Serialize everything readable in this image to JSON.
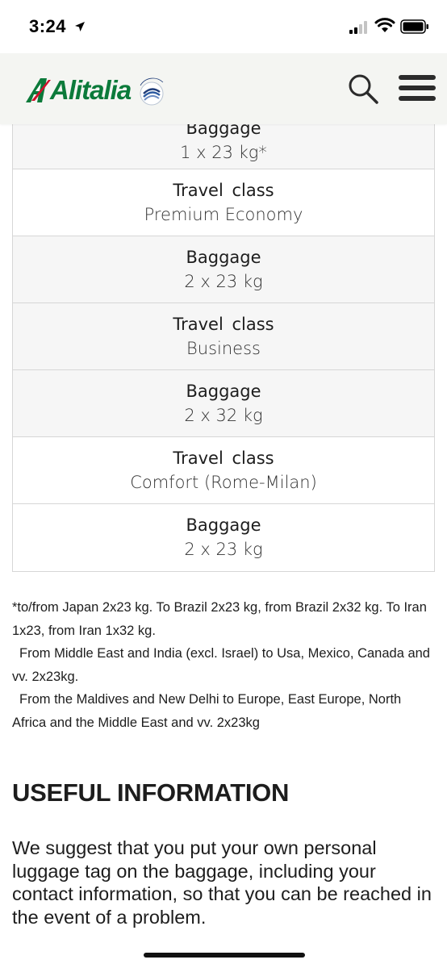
{
  "status_bar": {
    "time": "3:24"
  },
  "header": {
    "brand": "Alitalia",
    "partner_badge": "SKYTEAM",
    "brand_color": "#0b7a3a",
    "accent_color": "#d0102c",
    "search_icon": "search-icon",
    "menu_icon": "hamburger-menu-icon"
  },
  "table": {
    "rows": [
      {
        "label": "Baggage",
        "value": "1 x 23 kg*"
      },
      {
        "label": "Travel  class",
        "value": "Premium Economy"
      },
      {
        "label": "Baggage",
        "value": "2 x 23 kg"
      },
      {
        "label": "Travel  class",
        "value": "Business"
      },
      {
        "label": "Baggage",
        "value": "2 x 32 kg"
      },
      {
        "label": "Travel  class",
        "value": "Comfort (Rome-Milan)"
      },
      {
        "label": "Baggage",
        "value": "2 x 23 kg"
      }
    ]
  },
  "footnote": {
    "line1": "*to/from Japan 2x23 kg. To Brazil 2x23 kg, from Brazil 2x32 kg. To Iran 1x23, from Iran 1x32 kg.",
    "line2": "From Middle East and India (excl. Israel)  to Usa, Mexico, Canada and vv.  2x23kg.",
    "line3": "From the Maldives and New Delhi to Europe, East Europe, North Africa and the Middle East and vv.  2x23kg"
  },
  "useful_info": {
    "title": "USEFUL INFORMATION",
    "body": "We suggest that you put your own personal luggage tag on the baggage, including your contact information, so that you can be reached in the event of a problem."
  }
}
